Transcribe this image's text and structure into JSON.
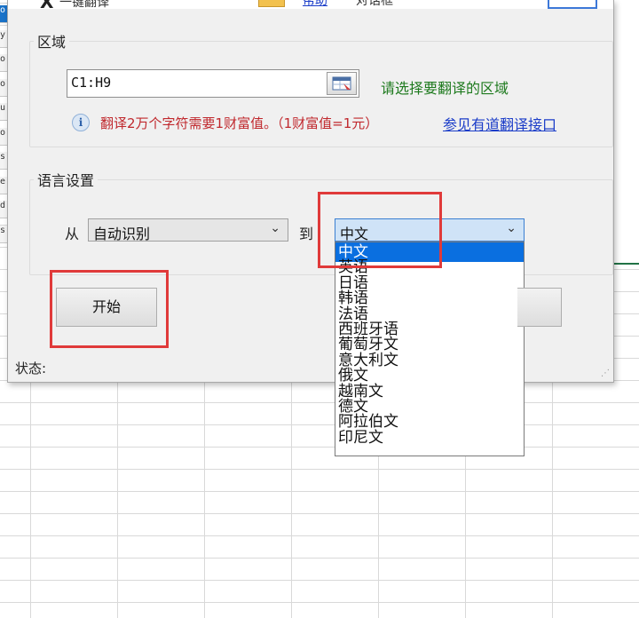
{
  "dialog": {
    "title_text": "一键翻译",
    "title_link": "帮助",
    "title_text2": "对话框",
    "logo_text": "X"
  },
  "region": {
    "legend": "区域",
    "range_value": "C1:H9",
    "hint": "请选择要翻译的区域",
    "info_text": "翻译2万个字符需要1财富值。（1财富值=1元）",
    "info_link": "参见有道翻译接口"
  },
  "language": {
    "legend": "语言设置",
    "from_label": "从",
    "from_value": "自动识别",
    "to_label": "到",
    "to_value": "中文",
    "options": [
      "中文",
      "英语",
      "日语",
      "韩语",
      "法语",
      "西班牙语",
      "葡萄牙文",
      "意大利文",
      "俄文",
      "越南文",
      "德文",
      "阿拉伯文",
      "印尼文"
    ],
    "selected_index": 0
  },
  "buttons": {
    "start_label": "开始"
  },
  "status": {
    "label": "状态:"
  },
  "sheet": {
    "row_tab_chars": [
      "o",
      "y",
      "o",
      "o",
      "u",
      "o",
      "s",
      "e",
      "d",
      "s"
    ]
  }
}
